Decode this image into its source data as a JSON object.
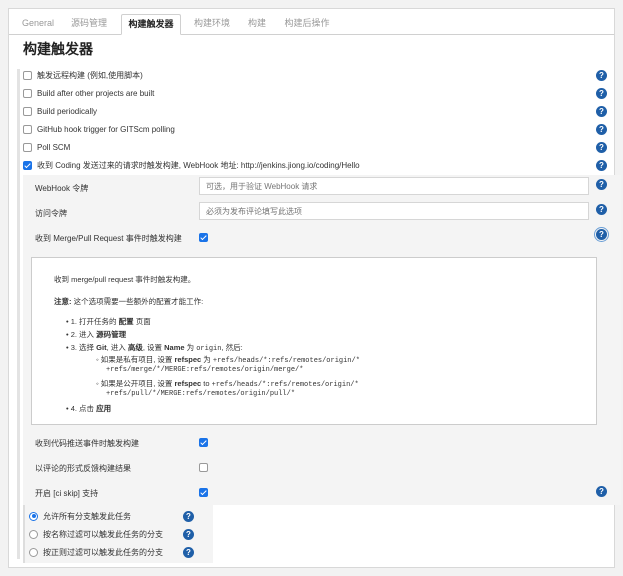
{
  "tabs": [
    {
      "label": "General"
    },
    {
      "label": "源码管理"
    },
    {
      "label": "构建触发器"
    },
    {
      "label": "构建环境"
    },
    {
      "label": "构建"
    },
    {
      "label": "构建后操作"
    }
  ],
  "section": {
    "title": "构建触发器"
  },
  "triggers": [
    {
      "label": "触发远程构建 (例如,使用脚本)",
      "checked": false
    },
    {
      "label": "Build after other projects are built",
      "checked": false
    },
    {
      "label": "Build periodically",
      "checked": false
    },
    {
      "label": "GitHub hook trigger for GITScm polling",
      "checked": false
    },
    {
      "label": "Poll SCM",
      "checked": false
    },
    {
      "label": "收到 Coding 发送过来的请求时触发构建, WebHook 地址: http://jenkins.jiong.io/coding/Hello",
      "checked": true
    }
  ],
  "coding": {
    "webhook_token_label": "WebHook 令牌",
    "webhook_token_placeholder": "可选，用于验证 WebHook 请求",
    "access_token_label": "访问令牌",
    "access_token_placeholder": "必须为发布评论填写此选项",
    "merge_request_label": "收到 Merge/Pull Request 事件时触发构建",
    "push_label": "收到代码推送事件时触发构建",
    "comment_label": "以评论的形式反馈构建结果",
    "ci_skip_label": "开启 [ci skip] 支持"
  },
  "info": {
    "intro": "收到 merge/pull request 事件时触发构建。",
    "note_bold": "注意:",
    "note_rest": " 这个选项需要一些额外的配置才能工作:",
    "step1_pre": "1. 打开任务的 ",
    "step1_bold": "配置",
    "step1_post": " 页面",
    "step2_pre": "2. 进入 ",
    "step2_bold": "源码管理",
    "step3_pre": "3. 选择 ",
    "step3_git": "Git",
    "step3_mid": ", 进入 ",
    "step3_adv": "高级",
    "step3_set": ", 设置 ",
    "step3_name": "Name",
    "step3_as": " 为 ",
    "step3_origin": "origin",
    "step3_then": ", 然后:",
    "private_pre": "如果是私有项目, 设置 ",
    "refspec": "refspec",
    "private_as": " 为 ",
    "private_code1": "+refs/heads/*:refs/remotes/origin/*",
    "private_code2": "+refs/merge/*/MERGE:refs/remotes/origin/merge/*",
    "public_pre": "如果是公开项目, 设置 ",
    "public_to": " to ",
    "public_code1": "+refs/heads/*:refs/remotes/origin/*",
    "public_code2": "+refs/pull/*/MERGE:refs/remotes/origin/pull/*",
    "step4_pre": "4. 点击 ",
    "step4_bold": "应用"
  },
  "branch_options": [
    {
      "label": "允许所有分支触发此任务",
      "checked": true
    },
    {
      "label": "按名称过滤可以触发此任务的分支",
      "checked": false
    },
    {
      "label": "按正则过滤可以触发此任务的分支",
      "checked": false
    }
  ],
  "help_icon": "?",
  "colors": {
    "accent": "#1a73e8",
    "help": "#1f5fa8"
  }
}
